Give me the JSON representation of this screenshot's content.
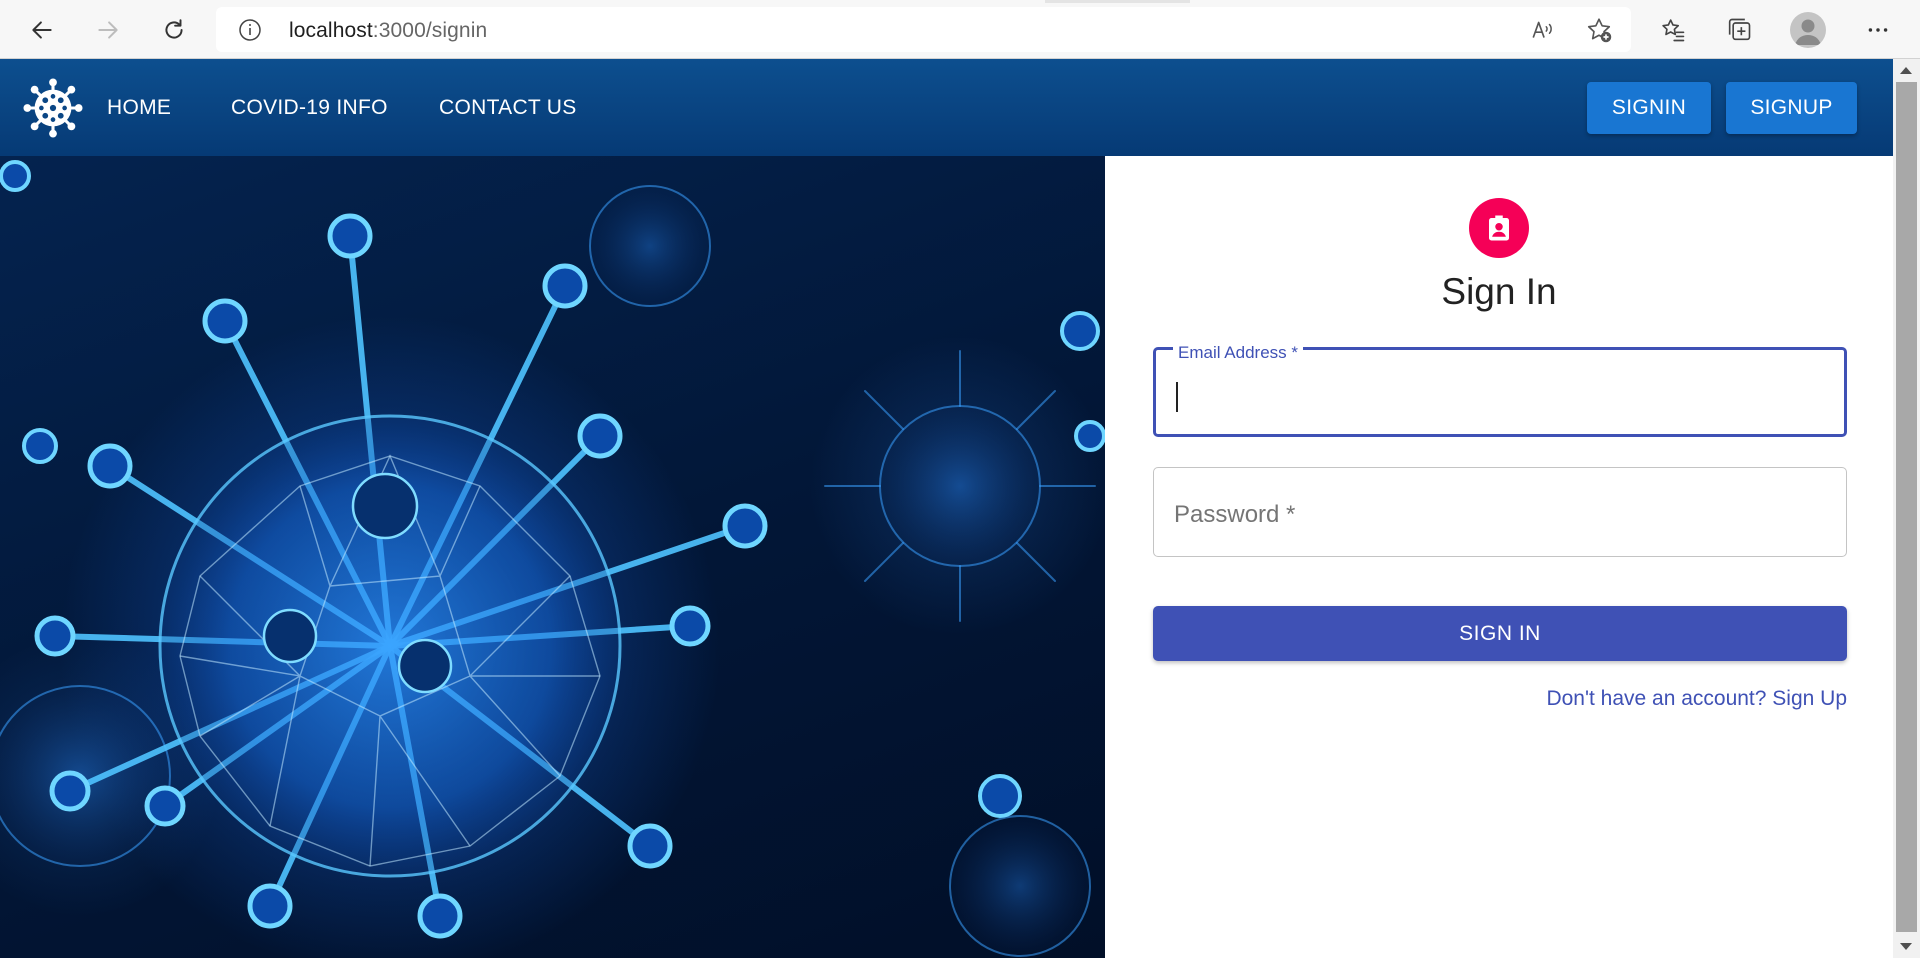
{
  "browser": {
    "url_host": "localhost",
    "url_path": ":3000/signin",
    "icons": [
      "back-icon",
      "forward-icon",
      "refresh-icon",
      "site-info-icon",
      "read-aloud-icon",
      "add-favorite-icon",
      "favorites-icon",
      "collections-icon",
      "profile-icon",
      "more-icon"
    ]
  },
  "nav": {
    "logo_icon": "virus-icon",
    "links": [
      {
        "label": "HOME"
      },
      {
        "label": "COVID-19 INFO"
      },
      {
        "label": "CONTACT US"
      }
    ],
    "signin_label": "SIGNIN",
    "signup_label": "SIGNUP",
    "background_color": "#0a4685",
    "button_color": "#1976d2"
  },
  "hero": {
    "image_subject": "virus-illustration"
  },
  "signin": {
    "avatar_icon": "badge-icon",
    "avatar_color": "#f50057",
    "title": "Sign In",
    "email_label": "Email Address *",
    "email_value": "",
    "password_placeholder": "Password *",
    "password_value": "",
    "submit_label": "SIGN IN",
    "signup_link": "Don't have an account? Sign Up",
    "primary_color": "#3f51b5"
  }
}
